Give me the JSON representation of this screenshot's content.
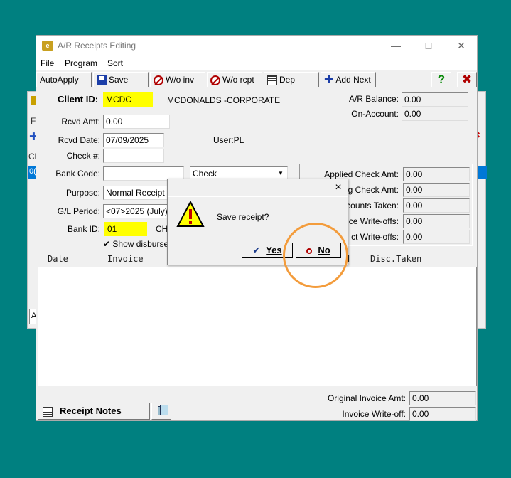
{
  "window": {
    "title": "A/R Receipts Editing",
    "logo_text": "e"
  },
  "menu": [
    "File",
    "Program",
    "Sort"
  ],
  "toolbar": {
    "autoapply": "AutoApply",
    "save": "Save",
    "wo_inv": "W/o inv",
    "wo_rcpt": "W/o rcpt",
    "dep": "Dep",
    "add_next": "Add Next",
    "help": "?",
    "close": "✖"
  },
  "form": {
    "client_id_label": "Client ID:",
    "client_id": "MCDC",
    "client_name": "MCDONALDS -CORPORATE",
    "rcvd_amt_label": "Rcvd Amt:",
    "rcvd_amt": "0.00",
    "rcvd_date_label": "Rcvd Date:",
    "rcvd_date": "07/09/2025",
    "user": "User:PL",
    "check_no_label": "Check #:",
    "check_no": "",
    "bank_code_label": "Bank Code:",
    "bank_code": "",
    "payment_type": "Check",
    "purpose_label": "Purpose:",
    "purpose": "Normal Receipt",
    "gl_period_label": "G/L Period:",
    "gl_period": "<07>2025 (July)",
    "bank_id_label": "Bank ID:",
    "bank_id": "01",
    "bank_id_desc": "CH",
    "show_disburse": "Show disburse"
  },
  "balances": {
    "ar_balance_label": "A/R Balance:",
    "ar_balance": "0.00",
    "on_account_label": "On-Account:",
    "on_account": "0.00"
  },
  "applied": {
    "applied_check_amt_label": "Applied Check Amt:",
    "applied_check_amt": "0.00",
    "remaining_check_amt_label": "g Check Amt:",
    "remaining_check_amt": "0.00",
    "discounts_taken_label": "counts Taken:",
    "discounts_taken": "0.00",
    "invoice_writeoffs_label": "ce Write-offs:",
    "invoice_writeoffs": "0.00",
    "direct_writeoffs_label": "ct Write-offs:",
    "direct_writeoffs": "0.00"
  },
  "grid": {
    "col_date": "Date",
    "col_invoice": "Invoice",
    "col_d": "d",
    "col_disc_taken": "Disc.Taken"
  },
  "footer": {
    "receipt_notes": "Receipt Notes",
    "original_invoice_amt_label": "Original Invoice Amt:",
    "original_invoice_amt": "0.00",
    "invoice_writeoff_label": "Invoice Write-off:",
    "invoice_writeoff": "0.00"
  },
  "dialog": {
    "message": "Save receipt?",
    "yes": "Yes",
    "no": "No",
    "close": "×"
  },
  "background_window": {
    "f_label": "F",
    "cl_label": "Cl",
    "row_text": "0(",
    "box_text": "A"
  },
  "colors": {
    "desktop": "#008080",
    "highlight": "#ffff00",
    "selection": "#0078d7",
    "ring": "#f39c3c"
  }
}
